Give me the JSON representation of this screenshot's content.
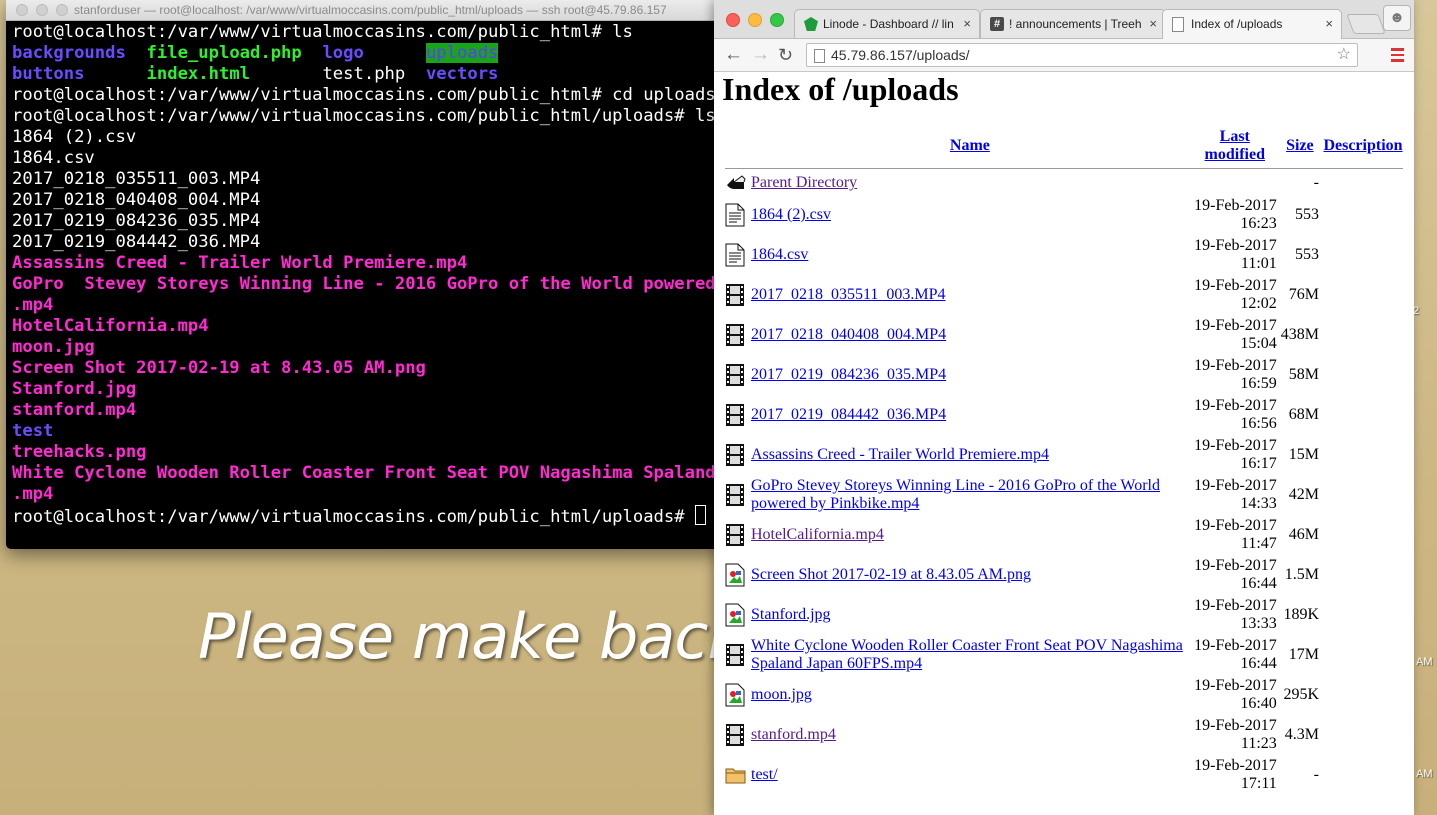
{
  "desktop": {
    "banner_text": "Please make backup",
    "fragments": [
      "2",
      "AM",
      "AM"
    ]
  },
  "terminal": {
    "title": "stanforduser — root@localhost: /var/www/virtualmoccasins.com/public_html/uploads — ssh root@45.79.86.157",
    "lines": [
      "root@localhost:/var/www/virtualmoccasins.com/public_html# ls",
      "root@localhost:/var/www/virtualmoccasins.com/public_html# cd uploads",
      "root@localhost:/var/www/virtualmoccasins.com/public_html/uploads# ls",
      "1864 (2).csv",
      "1864.csv",
      "2017_0218_035511_003.MP4",
      "2017_0218_040408_004.MP4",
      "2017_0219_084236_035.MP4",
      "2017_0219_084442_036.MP4",
      "Assassins Creed - Trailer World Premiere.mp4",
      "GoPro  Stevey Storeys Winning Line - 2016 GoPro of the World powered by",
      ".mp4",
      "HotelCalifornia.mp4",
      "moon.jpg",
      "Screen Shot 2017-02-19 at 8.43.05 AM.png",
      "Stanford.jpg",
      "stanford.mp4",
      "test",
      "treehacks.png",
      "White Cyclone Wooden Roller Coaster Front Seat POV Nagashima Spaland Ja",
      ".mp4",
      "root@localhost:/var/www/virtualmoccasins.com/public_html/uploads# "
    ],
    "ls_root": {
      "row1": [
        "backgrounds",
        "file_upload.php",
        "logo",
        "uploads"
      ],
      "row2": [
        "buttons",
        "index.html",
        "test.php",
        "vectors"
      ]
    }
  },
  "browser": {
    "tabs": [
      {
        "label": "Linode - Dashboard // lin",
        "fav_color": "#1f9a3c"
      },
      {
        "label": "! announcements | Treeh",
        "fav_color": "#4a4a4a"
      },
      {
        "label": "Index of /uploads",
        "fav_color": "#ffffff"
      }
    ],
    "close_glyph": "×",
    "url": "45.79.86.157/uploads/",
    "page": {
      "heading": "Index of /uploads",
      "columns": {
        "name": "Name",
        "last_modified": "Last modified",
        "size": "Size",
        "description": "Description"
      },
      "parent": {
        "label": "Parent Directory",
        "size": "-"
      },
      "rows": [
        {
          "icon": "text",
          "name": "1864 (2).csv",
          "date": "19-Feb-2017",
          "time": "16:23",
          "size": "553"
        },
        {
          "icon": "text",
          "name": "1864.csv",
          "date": "19-Feb-2017",
          "time": "11:01",
          "size": "553"
        },
        {
          "icon": "film",
          "name": "2017_0218_035511_003.MP4",
          "date": "19-Feb-2017",
          "time": "12:02",
          "size": "76M"
        },
        {
          "icon": "film",
          "name": "2017_0218_040408_004.MP4",
          "date": "19-Feb-2017",
          "time": "15:04",
          "size": "438M"
        },
        {
          "icon": "film",
          "name": "2017_0219_084236_035.MP4",
          "date": "19-Feb-2017",
          "time": "16:59",
          "size": "58M"
        },
        {
          "icon": "film",
          "name": "2017_0219_084442_036.MP4",
          "date": "19-Feb-2017",
          "time": "16:56",
          "size": "68M"
        },
        {
          "icon": "film",
          "name": "Assassins Creed - Trailer World Premiere.mp4",
          "date": "19-Feb-2017",
          "time": "16:17",
          "size": "15M"
        },
        {
          "icon": "film",
          "name": "GoPro Stevey Storeys Winning Line - 2016 GoPro of the World powered by Pinkbike.mp4",
          "date": "19-Feb-2017",
          "time": "14:33",
          "size": "42M"
        },
        {
          "icon": "film",
          "name": "HotelCalifornia.mp4",
          "date": "19-Feb-2017",
          "time": "11:47",
          "size": "46M",
          "visited": true
        },
        {
          "icon": "image",
          "name": "Screen Shot 2017-02-19 at 8.43.05 AM.png",
          "date": "19-Feb-2017",
          "time": "16:44",
          "size": "1.5M"
        },
        {
          "icon": "image",
          "name": "Stanford.jpg",
          "date": "19-Feb-2017",
          "time": "13:33",
          "size": "189K"
        },
        {
          "icon": "film",
          "name": "White Cyclone Wooden Roller Coaster Front Seat POV Nagashima Spaland Japan 60FPS.mp4",
          "date": "19-Feb-2017",
          "time": "16:44",
          "size": "17M"
        },
        {
          "icon": "image",
          "name": "moon.jpg",
          "date": "19-Feb-2017",
          "time": "16:40",
          "size": "295K"
        },
        {
          "icon": "film",
          "name": "stanford.mp4",
          "date": "19-Feb-2017",
          "time": "11:23",
          "size": "4.3M",
          "visited": true
        },
        {
          "icon": "folder",
          "name": "test/",
          "date": "19-Feb-2017",
          "time": "17:11",
          "size": "-"
        }
      ]
    }
  }
}
